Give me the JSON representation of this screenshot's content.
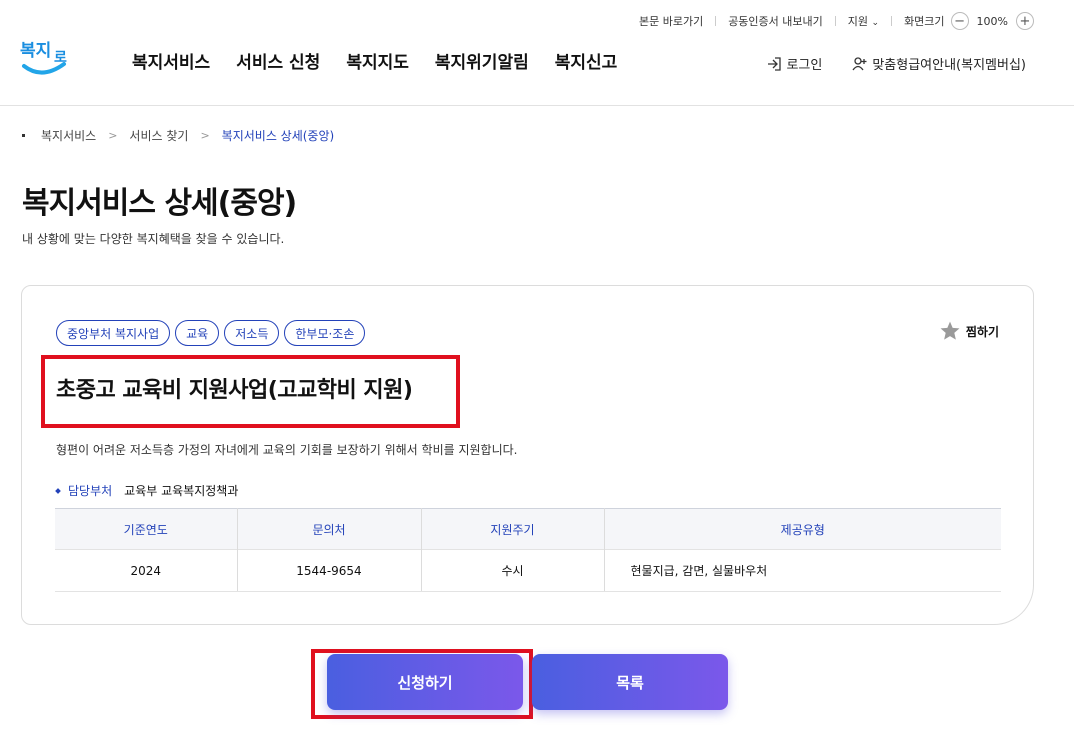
{
  "util": {
    "skip": "본문 바로가기",
    "cert": "공동인증서 내보내기",
    "lang": "지원",
    "zoom_label": "화면크기",
    "zoom_value": "100%",
    "zoom_minus": "−",
    "zoom_plus": "+"
  },
  "logo": {
    "text_top": "복지",
    "text_right": "로"
  },
  "nav": [
    "복지서비스",
    "서비스 신청",
    "복지지도",
    "복지위기알림",
    "복지신고"
  ],
  "auth": {
    "login": "로그인",
    "member": "맞춤형급여안내(복지멤버십)"
  },
  "breadcrumb": [
    "복지서비스",
    "서비스 찾기",
    "복지서비스 상세(중앙)"
  ],
  "page": {
    "title": "복지서비스 상세(중앙)",
    "desc": "내 상황에 맞는 다양한 복지혜택을 찾을 수 있습니다."
  },
  "service": {
    "tags": [
      "중앙부처 복지사업",
      "교육",
      "저소득",
      "한부모·조손"
    ],
    "fav_label": "찜하기",
    "title": "초중고 교육비 지원사업(고교학비 지원)",
    "desc": "형편이 어려운 저소득층 가정의 자녀에게 교육의 기회를 보장하기 위해서 학비를 지원합니다.",
    "dept_label": "담당부처",
    "dept_value": "교육부 교육복지정책과",
    "table": {
      "headers": [
        "기준연도",
        "문의처",
        "지원주기",
        "제공유형"
      ],
      "row": [
        "2024",
        "1544-9654",
        "수시",
        "현물지급, 감면, 실물바우처"
      ]
    }
  },
  "buttons": {
    "apply": "신청하기",
    "list": "목록"
  },
  "colors": {
    "accent": "#2342b9",
    "highlight": "#e0101e",
    "button_start": "#4a5fe0",
    "button_end": "#7b58ea"
  }
}
